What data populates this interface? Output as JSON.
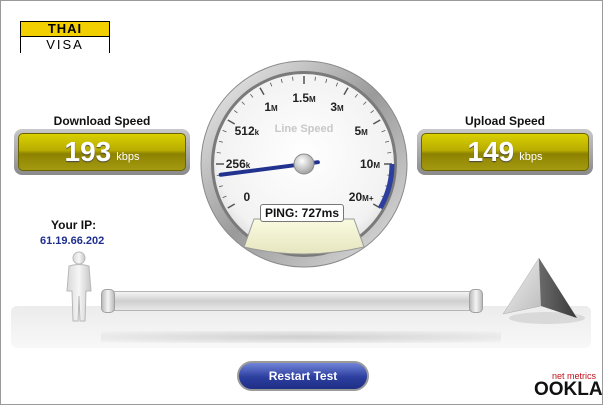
{
  "logo": {
    "top": "THAI",
    "bottom": "VISA"
  },
  "download": {
    "title": "Download Speed",
    "value": "193",
    "unit": "kbps"
  },
  "upload": {
    "title": "Upload Speed",
    "value": "149",
    "unit": "kbps"
  },
  "ip": {
    "label": "Your IP:",
    "value": "61.19.66.202"
  },
  "gauge": {
    "title": "Line Speed",
    "ticks": [
      {
        "label": "0",
        "sub": ""
      },
      {
        "label": "256",
        "sub": "k"
      },
      {
        "label": "512",
        "sub": "k"
      },
      {
        "label": "1",
        "sub": "M"
      },
      {
        "label": "1.5",
        "sub": "M"
      },
      {
        "label": "3",
        "sub": "M"
      },
      {
        "label": "5",
        "sub": "M"
      },
      {
        "label": "10",
        "sub": "M"
      },
      {
        "label": "20",
        "sub": "M+"
      }
    ],
    "needle_value_kbps": 193
  },
  "ping": {
    "label": "PING:",
    "value": "727ms"
  },
  "restart_label": "Restart Test",
  "branding": {
    "tagline": "net metrics",
    "name": "OOKLA"
  },
  "colors": {
    "speed_fill": "#b9ad00",
    "accent_blue": "#2c3e9e",
    "ip_blue": "#1f2f8f",
    "needle": "#22338f"
  },
  "icons": {
    "person": "person-silhouette-icon",
    "server": "pyramid-server-icon",
    "gauge": "speedometer-icon"
  }
}
